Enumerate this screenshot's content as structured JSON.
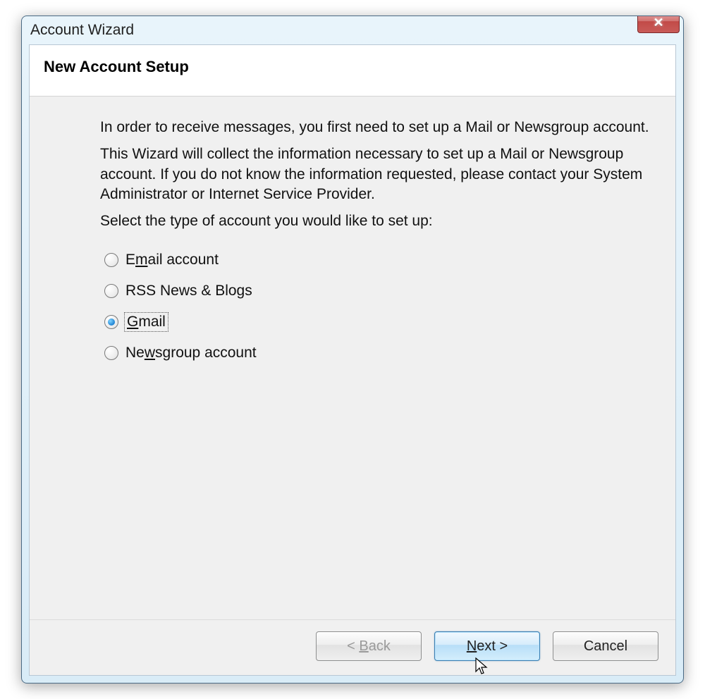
{
  "window": {
    "title": "Account Wizard"
  },
  "header": {
    "title": "New Account Setup"
  },
  "body": {
    "para1": "In order to receive messages, you first need to set up a Mail or Newsgroup account.",
    "para2": "This Wizard will collect the information necessary to set up a Mail or Newsgroup account. If you do not know the information requested, please contact your System Administrator or Internet Service Provider.",
    "para3": "Select the type of account you would like to set up:"
  },
  "options": {
    "email": {
      "pre": "E",
      "mnemonic": "m",
      "post": "ail account",
      "selected": false
    },
    "rss": {
      "pre": "RSS News & Blogs",
      "mnemonic": "",
      "post": "",
      "selected": false
    },
    "gmail": {
      "pre": "",
      "mnemonic": "G",
      "post": "mail",
      "selected": true
    },
    "news": {
      "pre": "Ne",
      "mnemonic": "w",
      "post": "sgroup account",
      "selected": false
    }
  },
  "buttons": {
    "back": {
      "pre": "< ",
      "mnemonic": "B",
      "post": "ack"
    },
    "next": {
      "pre": "",
      "mnemonic": "N",
      "post": "ext >"
    },
    "cancel": {
      "pre": "Cancel",
      "mnemonic": "",
      "post": ""
    }
  }
}
